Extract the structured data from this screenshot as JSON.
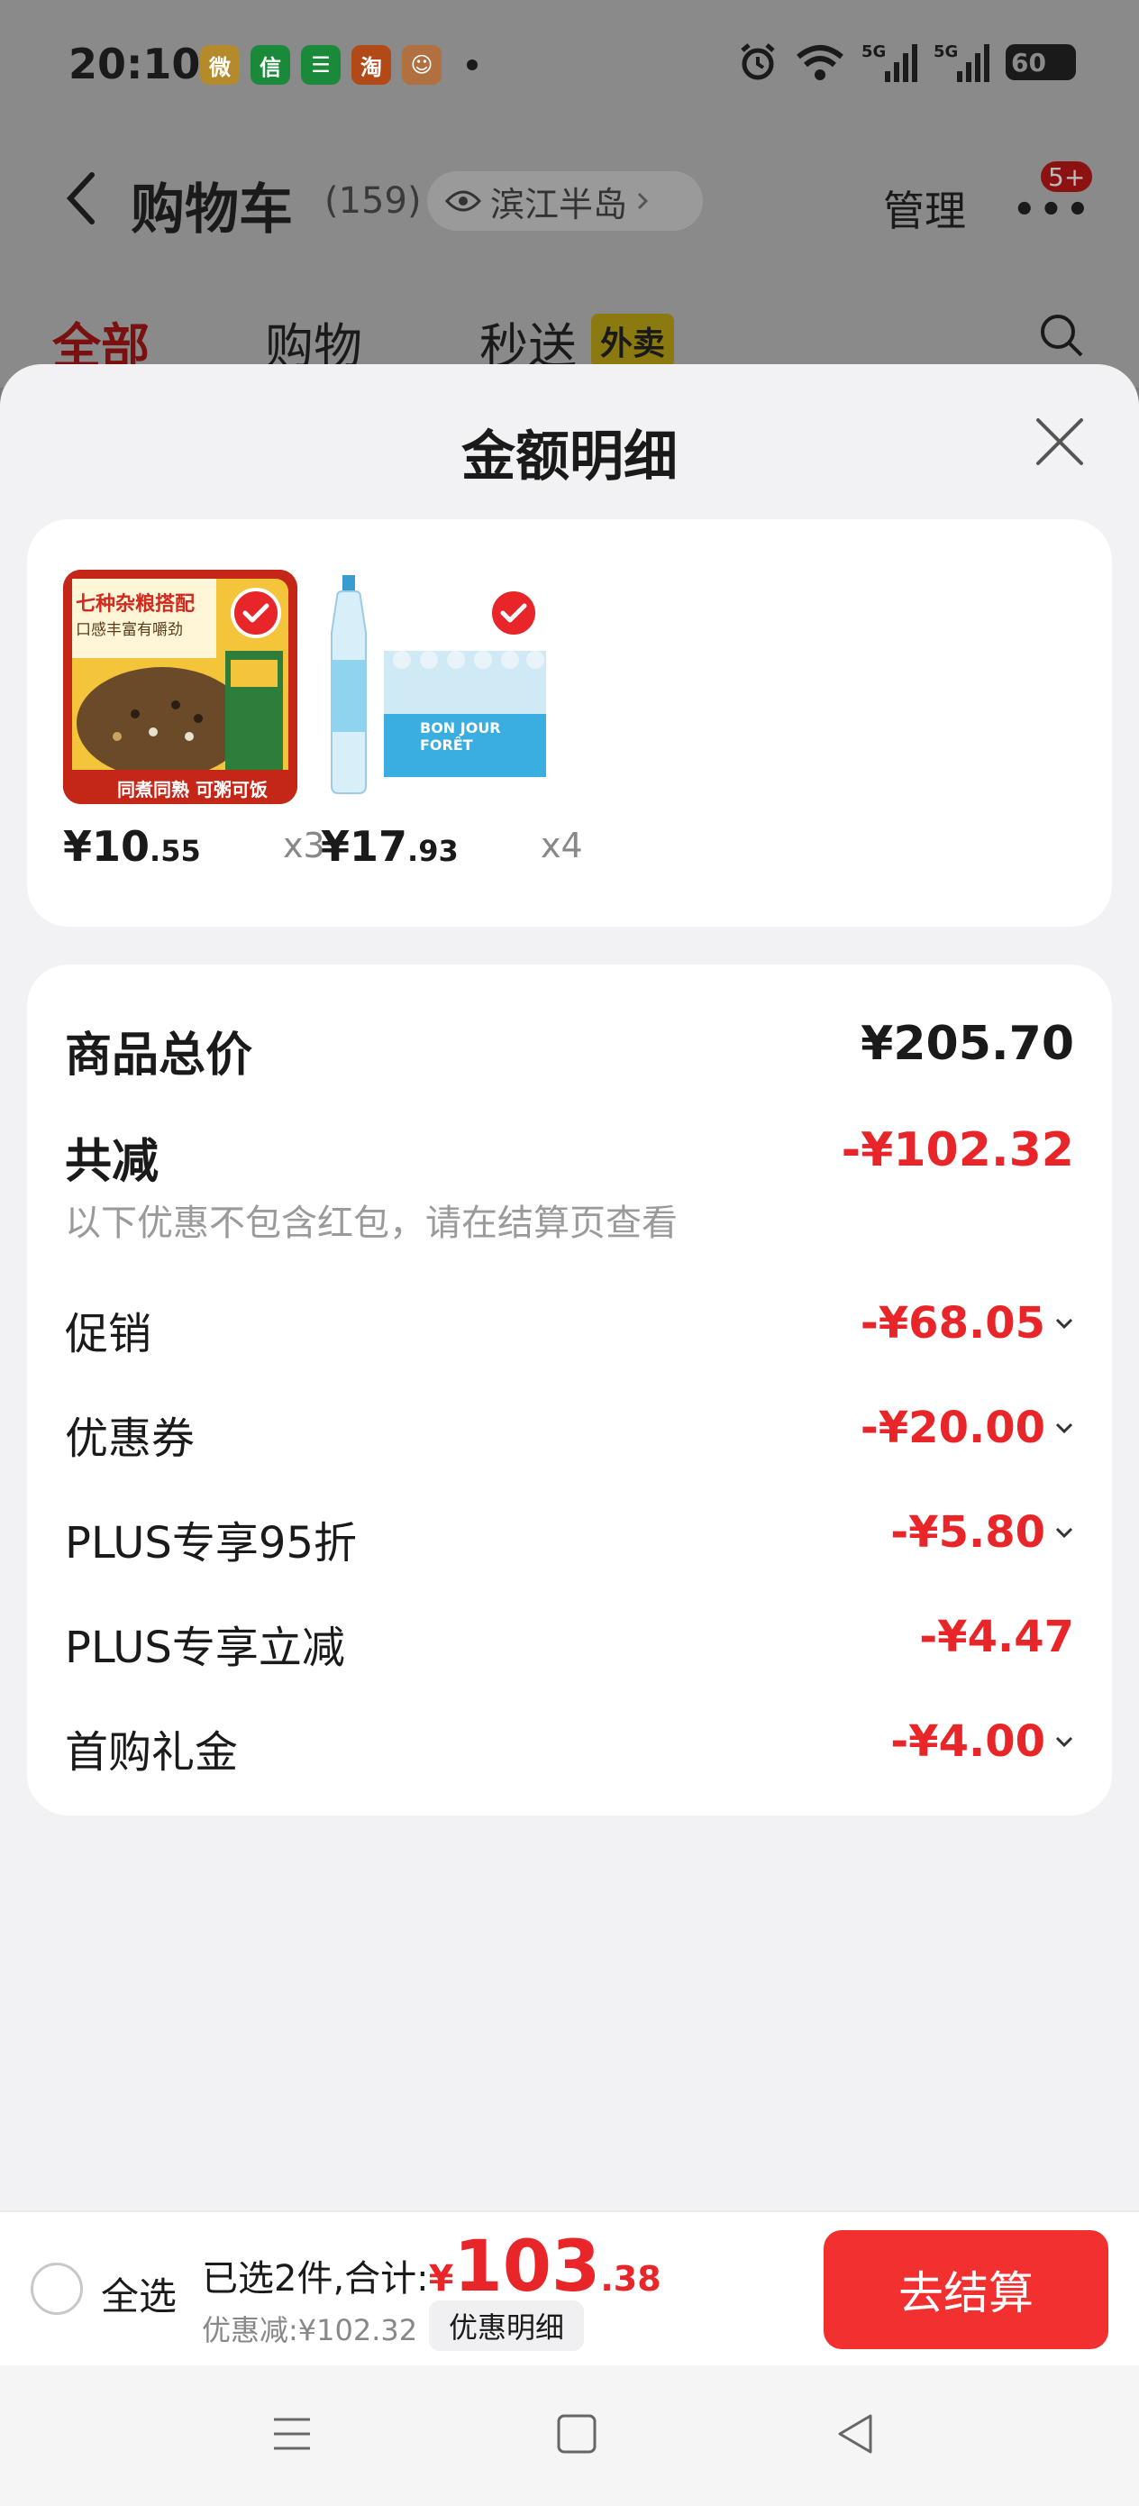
{
  "status_bar": {
    "time": "20:10",
    "apps": [
      {
        "icon": "weibo-icon",
        "glyph": "微",
        "color": "#b48a2a"
      },
      {
        "icon": "wechat-icon",
        "glyph": "信",
        "color": "#1a8a3a"
      },
      {
        "icon": "message-icon",
        "glyph": "☰",
        "color": "#1a8a3a"
      },
      {
        "icon": "taobao-icon",
        "glyph": "淘",
        "color": "#b24a18"
      },
      {
        "icon": "app-mascot-icon",
        "glyph": "☺",
        "color": "#b07040"
      }
    ],
    "signal_1_label": "5G",
    "signal_2_label": "5G",
    "battery": "60"
  },
  "header": {
    "title": "购物车",
    "count": "(159)",
    "location": "滨江半岛",
    "manage": "管理",
    "more_glyph": "•••",
    "badge": "5+"
  },
  "tabs": {
    "all": "全部",
    "shop": "购物",
    "fast": "秒送",
    "fast_tag": "外卖"
  },
  "sheet": {
    "title": "金额明细",
    "products": [
      {
        "name": "rice",
        "price_int": "¥10",
        "price_dec": ".55",
        "qty": "x3",
        "banner_top": "七种杂粮搭配",
        "banner_sub": "口感丰富有嚼劲",
        "banner_bottom": "同煮同熟 可粥可饭"
      },
      {
        "name": "water",
        "price_int": "¥17",
        "price_dec": ".93",
        "qty": "x4",
        "label_text": "BON JOUR FORÊT"
      }
    ],
    "total_label": "商品总价",
    "total_value": "¥205.70",
    "reduce_label": "共减",
    "reduce_value": "-¥102.32",
    "hint": "以下优惠不包含红包，请在结算页查看",
    "discounts": [
      {
        "label": "促销",
        "value": "-¥68.05",
        "expandable": true
      },
      {
        "label": "优惠券",
        "value": "-¥20.00",
        "expandable": true
      },
      {
        "label": "PLUS专享95折",
        "value": "-¥5.80",
        "expandable": true
      },
      {
        "label": "PLUS专享立减",
        "value": "-¥4.47",
        "expandable": false
      },
      {
        "label": "首购礼金",
        "value": "-¥4.00",
        "expandable": true
      }
    ]
  },
  "checkout": {
    "select_all": "全选",
    "summary_prefix": "已选2件,合计:",
    "yen": "¥",
    "total_int": "103",
    "total_dec": ".38",
    "discount_text": "优惠减:¥102.32",
    "detail_chip": "优惠明细",
    "button": "去结算"
  },
  "colors": {
    "accent": "#e8262a",
    "checkout_button": "#f23030"
  }
}
